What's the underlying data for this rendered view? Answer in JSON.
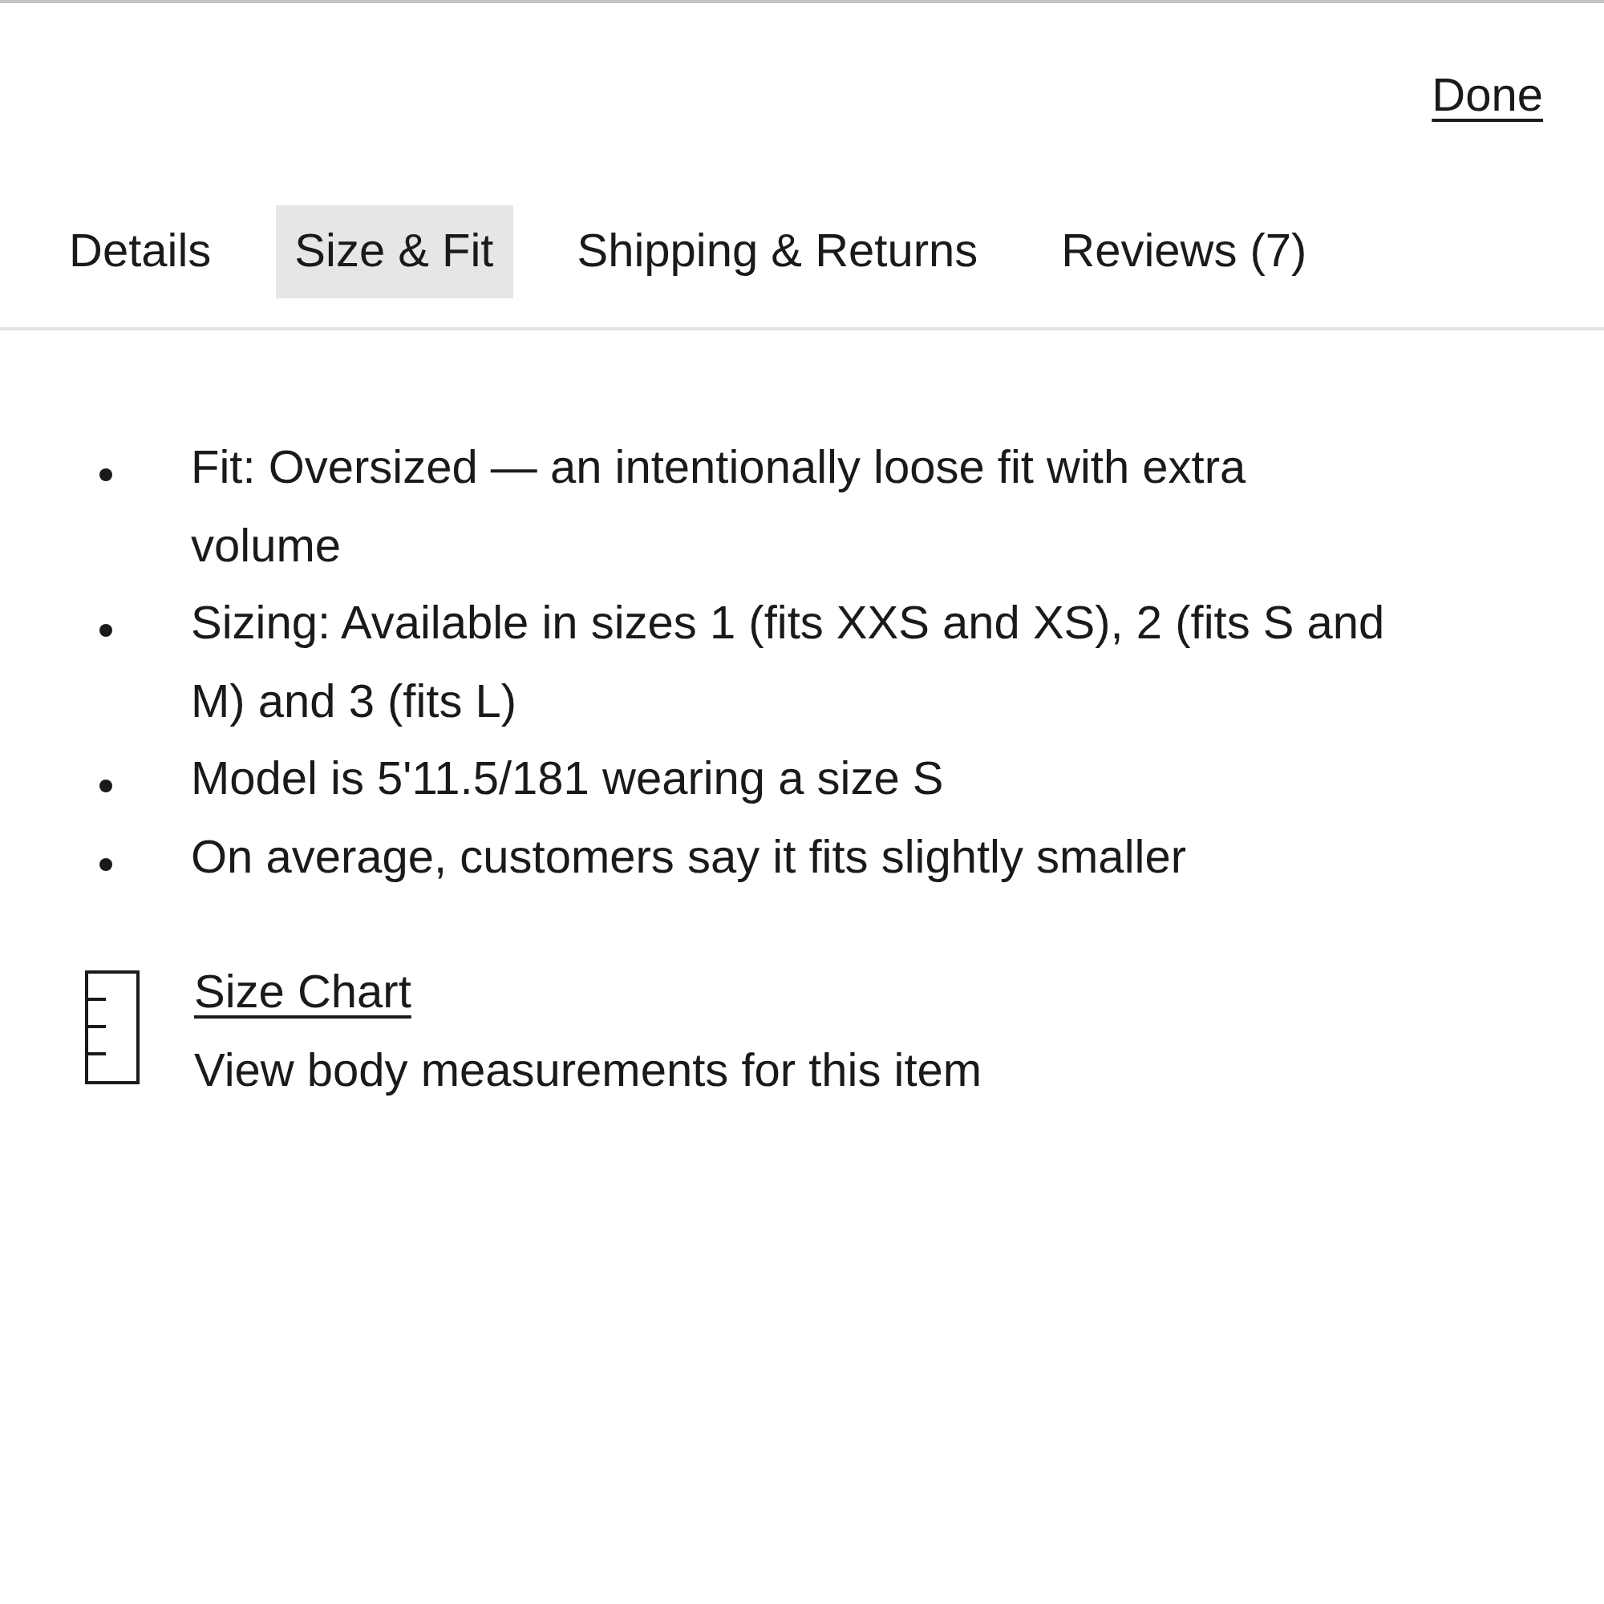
{
  "header": {
    "done_label": "Done"
  },
  "tabs": [
    {
      "label": "Details",
      "selected": false
    },
    {
      "label": "Size & Fit",
      "selected": true
    },
    {
      "label": "Shipping & Returns",
      "selected": false
    },
    {
      "label": "Reviews (7)",
      "selected": false
    }
  ],
  "fit_notes": [
    "Fit: Oversized — an intentionally loose fit with extra volume",
    "Sizing: Available in sizes 1 (fits XXS and XS), 2 (fits S and M) and 3 (fits L)",
    "Model is 5'11.5/181 wearing a size S",
    "On average, customers say it fits slightly smaller"
  ],
  "size_chart": {
    "link": "Size Chart",
    "description": "View body measurements for this item"
  }
}
